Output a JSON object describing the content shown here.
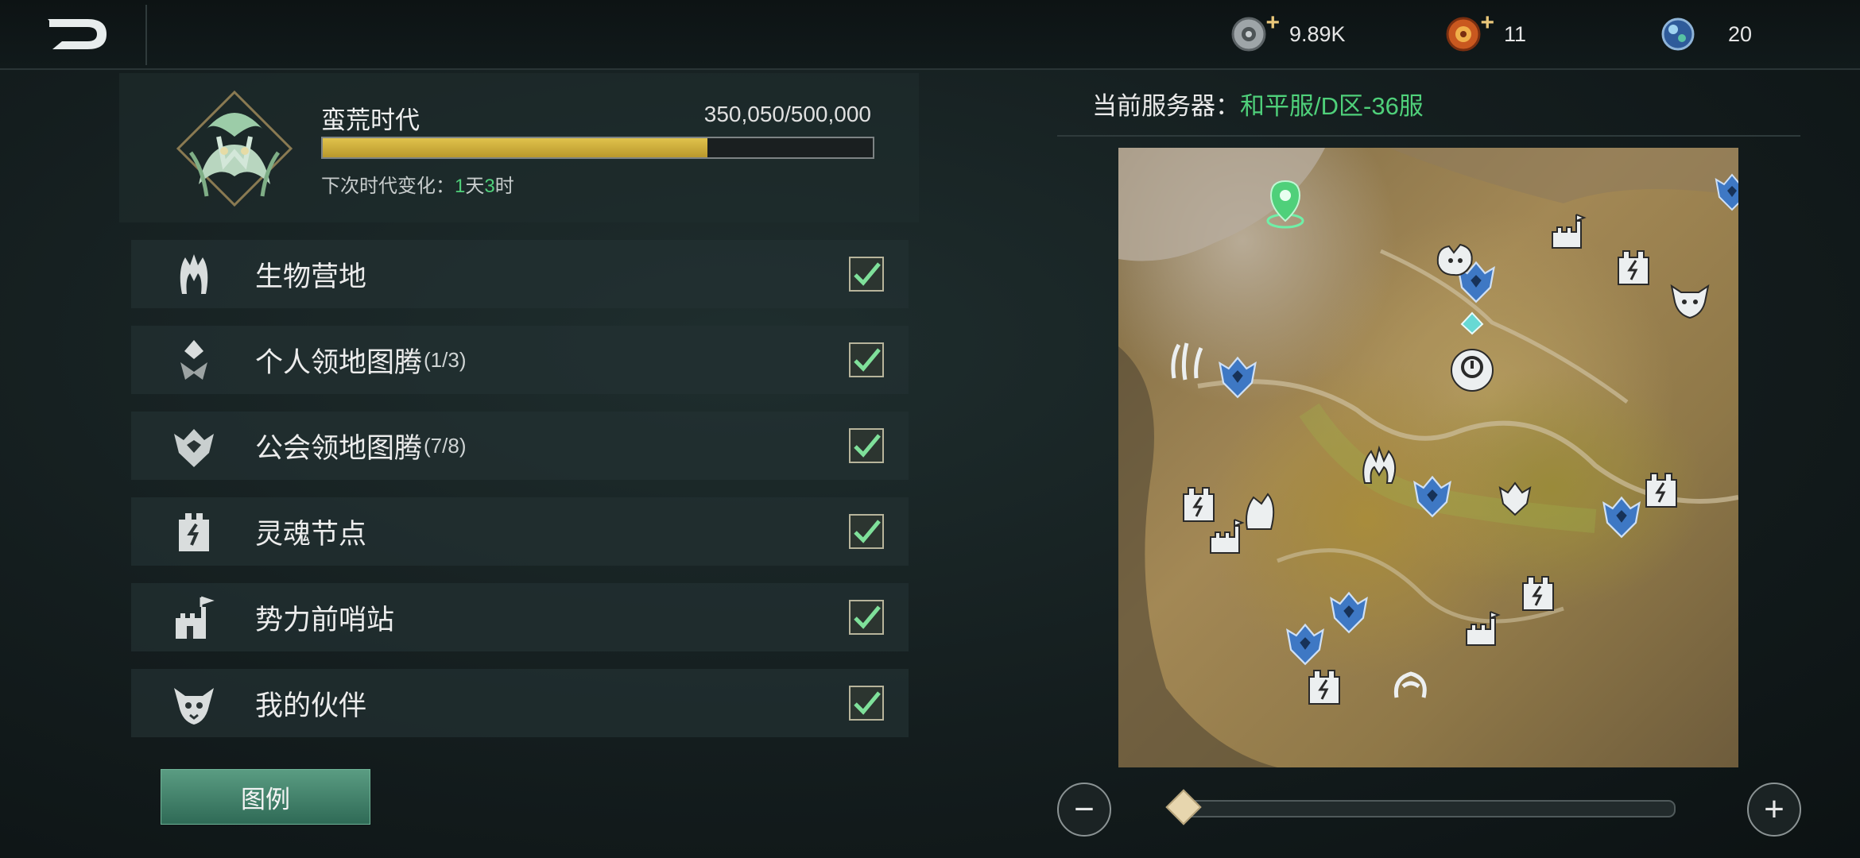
{
  "topbar": {
    "currencies": [
      {
        "name": "silver-coin",
        "value": "9.89K",
        "has_plus": true
      },
      {
        "name": "orange-gem",
        "value": "11",
        "has_plus": true
      },
      {
        "name": "blue-orb",
        "value": "20",
        "has_plus": false
      }
    ]
  },
  "era": {
    "title": "蛮荒时代",
    "progress_text": "350,050/500,000",
    "progress_fraction": 0.7,
    "next_change_label": "下次时代变化：",
    "next_days": "1",
    "days_unit": "天",
    "next_hours": "3",
    "hours_unit": "时"
  },
  "filters": [
    {
      "icon": "creature-camp-icon",
      "label": "生物营地",
      "count": "",
      "checked": true
    },
    {
      "icon": "personal-totem-icon",
      "label": "个人领地图腾",
      "count": "(1/3)",
      "checked": true
    },
    {
      "icon": "guild-totem-icon",
      "label": "公会领地图腾",
      "count": "(7/8)",
      "checked": true
    },
    {
      "icon": "soul-node-icon",
      "label": "灵魂节点",
      "count": "",
      "checked": true
    },
    {
      "icon": "faction-outpost-icon",
      "label": "势力前哨站",
      "count": "",
      "checked": true
    },
    {
      "icon": "companion-icon",
      "label": "我的伙伴",
      "count": "",
      "checked": true
    }
  ],
  "legend_button": "图例",
  "server": {
    "label": "当前服务器：",
    "name": "和平服/D区-36服"
  },
  "zoom": {
    "level": 0.02,
    "minus": "−",
    "plus": "+"
  },
  "colors": {
    "accent_green": "#4fd07a",
    "progress": "#d8b93f",
    "map_icon_blue": "#3e78c4"
  }
}
